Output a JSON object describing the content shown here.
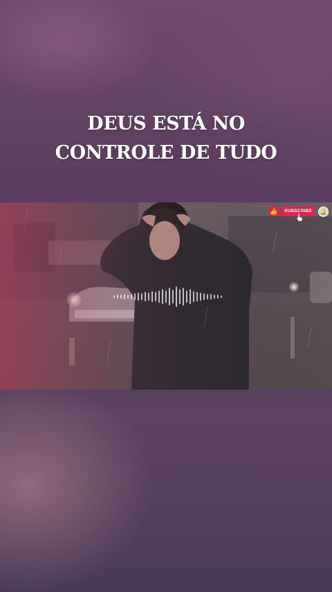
{
  "headline": {
    "line1": "DEUS ESTÁ NO",
    "line2": "CONTROLE DE TUDO"
  },
  "video": {
    "overlay": {
      "like_icon": "thumbs-up-icon",
      "like_glyph": "👍",
      "subscribe_label": "SUBSCRIBE",
      "bell_icon": "bell-icon",
      "bell_glyph": "🔔",
      "cursor_icon": "hand-pointer-icon"
    },
    "waveform_icon": "audio-waveform-icon"
  },
  "colors": {
    "subscribe_bg": "#e2244c",
    "headline_text": "#ffffff"
  }
}
